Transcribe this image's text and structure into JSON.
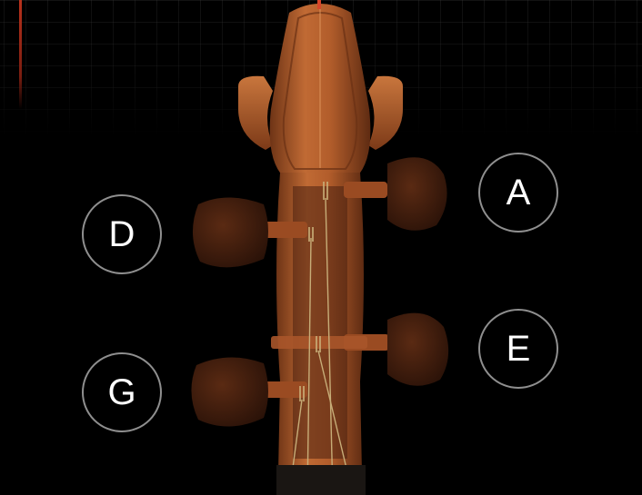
{
  "strings": {
    "left_top": {
      "note": "D"
    },
    "left_bottom": {
      "note": "G"
    },
    "right_top": {
      "note": "A"
    },
    "right_bottom": {
      "note": "E"
    }
  },
  "colors": {
    "background": "#000000",
    "wood": "#b4602e",
    "wood_dark": "#5c2a12",
    "peg": "#3a1a0c",
    "button_border": "#8f8f8f",
    "button_text": "#ffffff",
    "indicator": "#b9321c"
  },
  "icons": {
    "instrument": "violin-scroll-icon"
  }
}
